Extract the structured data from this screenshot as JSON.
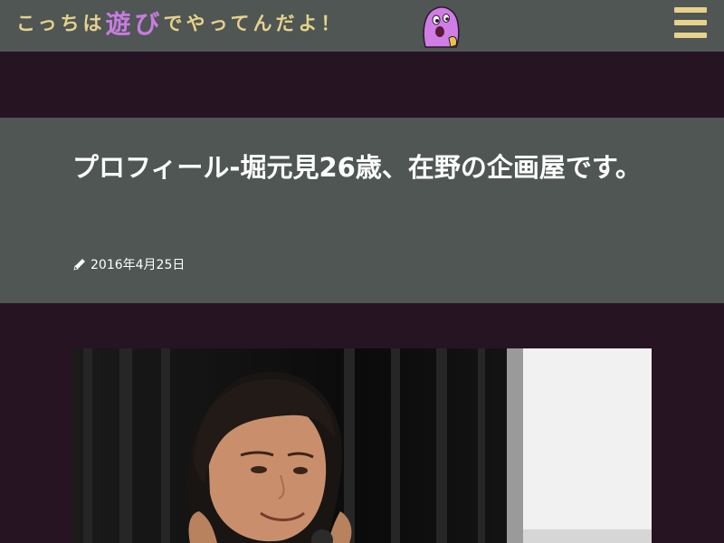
{
  "header": {
    "logo_prefix": "こっちは",
    "logo_accent": "遊び",
    "logo_suffix": "でやってんだよ！",
    "mascot_icon": "purple-mascot-icon",
    "menu_icon": "hamburger-menu-icon"
  },
  "post": {
    "title": "プロフィール-堀元見26歳、在野の企画屋です。",
    "date": "2016年4月25日",
    "date_icon": "pencil-icon"
  },
  "featured_image": {
    "alt": "Young man smiling while holding a microphone"
  },
  "colors": {
    "page_background": "#261423",
    "band_background": "#4f5654",
    "logo_yellow": "#e6d28a",
    "logo_purple": "#c87be0",
    "text": "#ffffff"
  }
}
